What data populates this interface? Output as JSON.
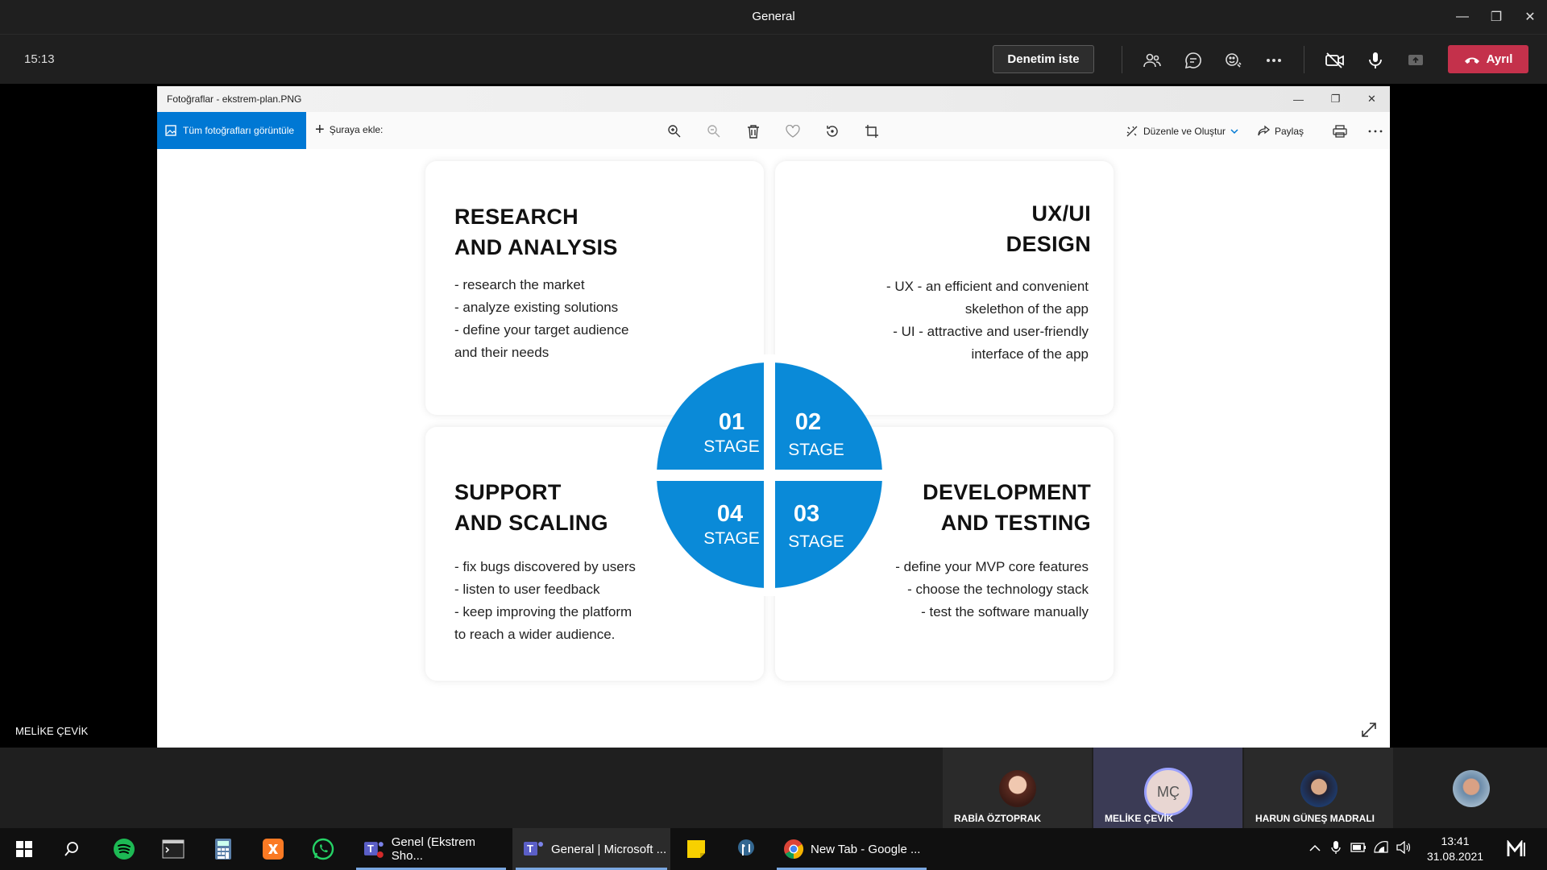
{
  "teams_window": {
    "title": "General",
    "clock": "15:13",
    "request_control_label": "Denetim iste",
    "leave_label": "Ayrıl",
    "presenter_name": "MELİKE ÇEVİK"
  },
  "photos_app": {
    "title": "Fotoğraflar - ekstrem-plan.PNG",
    "view_all_label": "Tüm fotoğrafları görüntüle",
    "add_to_label": "Şuraya ekle:",
    "edit_create_label": "Düzenle ve Oluştur",
    "share_label": "Paylaş"
  },
  "slide": {
    "cards": [
      {
        "title": "RESEARCH\nAND ANALYSIS",
        "items": [
          "- research the market",
          "- analyze existing solutions",
          "- define your target audience",
          "and their needs"
        ]
      },
      {
        "title": "UX/UI\nDESIGN",
        "items": [
          "- UX - an efficient and convenient",
          "skelethon of the app",
          "- UI - attractive and user-friendly",
          "interface of the app"
        ]
      },
      {
        "title": "SUPPORT\nAND SCALING",
        "items": [
          "- fix bugs discovered by users",
          "- listen to user feedback",
          "- keep improving the platform",
          "to reach a wider audience."
        ]
      },
      {
        "title": "DEVELOPMENT\nAND TESTING",
        "items": [
          "- define your MVP core features",
          "- choose the technology stack",
          "- test the software manually"
        ]
      }
    ],
    "stages": [
      {
        "num": "01",
        "label": "STAGE"
      },
      {
        "num": "02",
        "label": "STAGE"
      },
      {
        "num": "03",
        "label": "STAGE"
      },
      {
        "num": "04",
        "label": "STAGE"
      }
    ],
    "accent_color": "#0a8ad8"
  },
  "participants": [
    {
      "name": "RABİA ÖZTOPRAK"
    },
    {
      "name": "MELİKE ÇEVİK",
      "initials": "MÇ"
    },
    {
      "name": "HARUN GÜNEŞ MADRALI"
    }
  ],
  "taskbar": {
    "apps": [
      {
        "label": "Genel (Ekstrem Sho..."
      },
      {
        "label": "General | Microsoft ..."
      },
      {
        "label": "New Tab - Google ..."
      }
    ],
    "time": "13:41",
    "date": "31.08.2021"
  }
}
